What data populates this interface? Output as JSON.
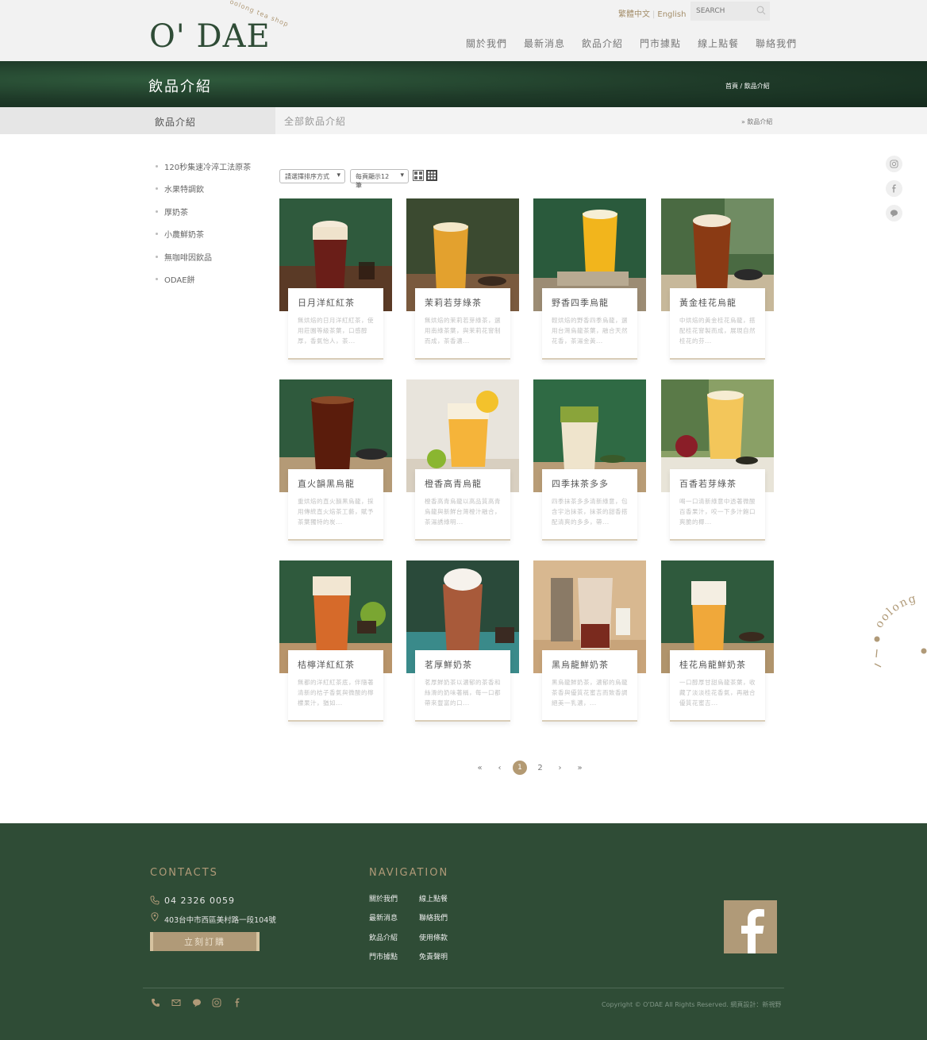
{
  "header": {
    "logo_text": "O' DAE",
    "logo_sub": "oolong tea shop",
    "lang_zh": "繁體中文",
    "lang_en": "English",
    "search_placeholder": "SEARCH",
    "nav": [
      "關於我們",
      "最新消息",
      "飲品介紹",
      "門市據點",
      "線上點餐",
      "聯絡我們"
    ]
  },
  "banner": {
    "title": "飲品介紹",
    "breadcrumb": "首頁 / 飲品介紹"
  },
  "subbar": {
    "left_title": "飲品介紹",
    "current": "全部飲品介紹",
    "crumb": "» 飲品介紹"
  },
  "sidebar": {
    "items": [
      "120秒集速冷淬工法原茶",
      "水果特調飲",
      "厚奶茶",
      "小農鮮奶茶",
      "無咖啡因飲品",
      "ODAE餅"
    ]
  },
  "toolbar": {
    "sort_label": "請選擇排序方式",
    "perpage_label": "每頁顯示12筆"
  },
  "products": [
    {
      "name": "日月洋紅紅茶",
      "desc": "無烘焙的日月洋紅紅茶，使用莊園等級茶葉，口感醇厚，香氣怡人，茶..."
    },
    {
      "name": "茉莉若芽綠茶",
      "desc": "無烘焙的茉莉若芽綠茶，選用南綠茶葉，與茉莉花窨制而成，茶香濃..."
    },
    {
      "name": "野香四季烏龍",
      "desc": "輕烘焙的野香四季烏龍，選用台灣烏龍茶葉，融合天然花香，茶湯金黃..."
    },
    {
      "name": "黃金桂花烏龍",
      "desc": "中烘焙的黃金桂花烏龍，搭配桂花窨製而成，展現自然桂花的芬..."
    },
    {
      "name": "直火韻黑烏龍",
      "desc": "重烘焙的直火韻黑烏龍，採用傳統直火焙茶工藝，賦予茶葉獨特的炭..."
    },
    {
      "name": "橙香高青烏龍",
      "desc": "橙香高青烏龍以高品質高青烏龍與新鮮台灣橙汁融合，茶湯誘綠明..."
    },
    {
      "name": "四季抹茶多多",
      "desc": "四季抹茶多多清新綠意，包含宇治抹茶，抹茶的甜香搭配清爽的多多，帶..."
    },
    {
      "name": "百香若芽綠茶",
      "desc": "喝一口清新綠意中透著微酸百香果汁，咬一下多汁飽口爽脆的椰..."
    },
    {
      "name": "桔檸洋紅紅茶",
      "desc": "無都的洋紅紅茶底，伴隨著清新的桔子香氣與微酸的檸檬果汁，猶如..."
    },
    {
      "name": "茗厚鮮奶茶",
      "desc": "茗厚鮮奶茶以濃郁的茶香和絲滑的奶味著稱，每一口都帶來豐富的口..."
    },
    {
      "name": "黑烏龍鮮奶茶",
      "desc": "黑烏龍鮮奶茶，濃郁的烏龍茶香與優質花蜜吉而致香調絕美一乳濃，..."
    },
    {
      "name": "桂花烏龍鮮奶茶",
      "desc": "一口醇厚甘甜烏龍茶葉，收藏了淡淡桂花香氣，再融合優質花蜜吉..."
    }
  ],
  "pagination": {
    "first": "«",
    "prev": "‹",
    "current": "1",
    "next_page": "2",
    "next": "›",
    "last": "»"
  },
  "footer": {
    "contacts_heading": "CONTACTS",
    "phone": "04 2326 0059",
    "address": "403台中市西區美村路一段104號",
    "order_button": "立刻訂購",
    "nav_heading": "NAVIGATION",
    "nav_col1": [
      "關於我們",
      "最新消息",
      "飲品介紹",
      "門市據點"
    ],
    "nav_col2": [
      "線上點餐",
      "聯絡我們",
      "使用條款",
      "免責聲明"
    ],
    "copyright": "Copyright © O'DAE All Rights Reserved. 網頁設計：新視野"
  },
  "side_decor_text": "oolong",
  "colors": {
    "brand_green": "#2f4c36",
    "accent_gold": "#b09a78"
  }
}
